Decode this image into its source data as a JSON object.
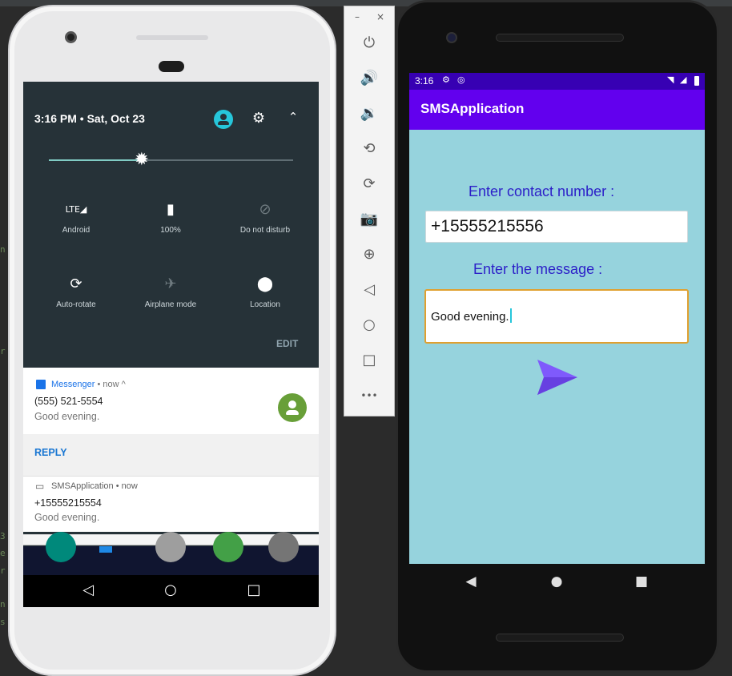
{
  "left_phone": {
    "quick_settings": {
      "time_date": "3:16 PM • Sat, Oct 23",
      "brightness": 0.38,
      "tiles": [
        {
          "label": "Android",
          "icon": "lte-signal-icon",
          "glyph": "LTE◢",
          "active": true
        },
        {
          "label": "100%",
          "icon": "battery-charging-icon",
          "glyph": "▮",
          "active": true
        },
        {
          "label": "Do not disturb",
          "icon": "do-not-disturb-icon",
          "glyph": "⊘",
          "active": false
        },
        {
          "label": "Auto-rotate",
          "icon": "auto-rotate-icon",
          "glyph": "⟳",
          "active": true
        },
        {
          "label": "Airplane mode",
          "icon": "airplane-icon",
          "glyph": "✈",
          "active": false
        },
        {
          "label": "Location",
          "icon": "location-pin-icon",
          "glyph": "⬤",
          "active": true
        }
      ],
      "edit_label": "EDIT"
    },
    "notifications": [
      {
        "app": "Messenger",
        "meta": "• now ^",
        "title": "(555) 521-5554",
        "body": "Good evening.",
        "action": "REPLY"
      },
      {
        "app": "SMSApplication",
        "meta": "• now",
        "title": "+15555215554",
        "body": "Good evening."
      }
    ]
  },
  "toolbar": {
    "minimize": "–",
    "close": "×",
    "buttons": [
      {
        "name": "power-icon",
        "glyph": "⏻"
      },
      {
        "name": "volume-up-icon",
        "glyph": "🔊"
      },
      {
        "name": "volume-down-icon",
        "glyph": "🔉"
      },
      {
        "name": "rotate-left-icon",
        "glyph": "⟲"
      },
      {
        "name": "rotate-right-icon",
        "glyph": "⟳"
      },
      {
        "name": "camera-icon",
        "glyph": "📷"
      },
      {
        "name": "zoom-icon",
        "glyph": "⊕"
      },
      {
        "name": "back-icon",
        "glyph": "◁"
      },
      {
        "name": "home-icon",
        "glyph": "○"
      },
      {
        "name": "overview-icon",
        "glyph": "□"
      },
      {
        "name": "more-icon",
        "glyph": "•••"
      }
    ]
  },
  "right_phone": {
    "status_time": "3:16",
    "app_title": "SMSApplication",
    "contact_label": "Enter contact number :",
    "contact_value": "+15555215556",
    "message_label": "Enter the message :",
    "message_value": "Good evening.",
    "colors": {
      "status_bar": "#3700b3",
      "app_bar": "#6200ee",
      "background": "#96d3dd",
      "label": "#2c1fc8",
      "send_button": "#7c4dff"
    }
  }
}
